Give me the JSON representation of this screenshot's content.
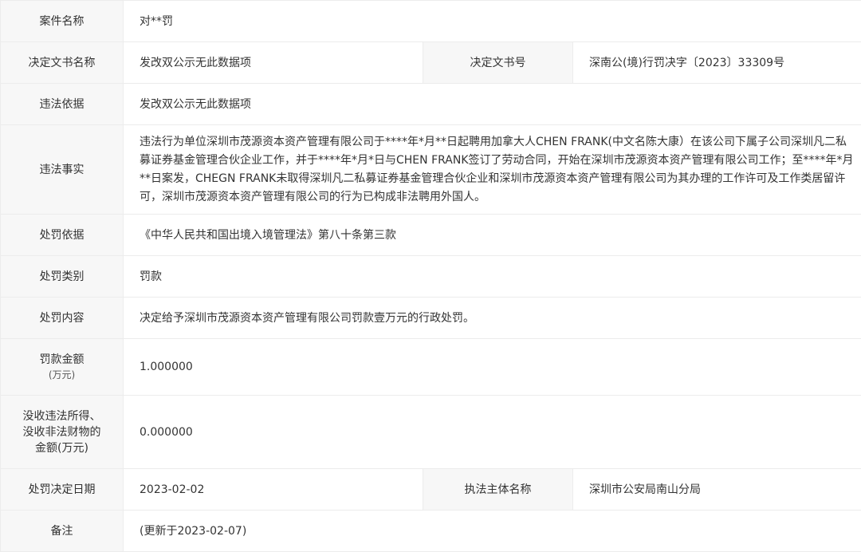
{
  "rows": {
    "case_name": {
      "label": "案件名称",
      "value": "对**罚"
    },
    "decision_doc_name": {
      "label": "决定文书名称",
      "value": "发改双公示无此数据项"
    },
    "decision_doc_no": {
      "label": "决定文书号",
      "value": "深南公(境)行罚决字〔2023〕33309号"
    },
    "violation_basis": {
      "label": "违法依据",
      "value": "发改双公示无此数据项"
    },
    "violation_facts": {
      "label": "违法事实",
      "value": "违法行为单位深圳市茂源资本资产管理有限公司于****年*月**日起聘用加拿大人CHEN FRANK(中文名陈大康）在该公司下属子公司深圳凡二私募证券基金管理合伙企业工作，并于****年*月*日与CHEN FRANK签订了劳动合同，开始在深圳市茂源资本资产管理有限公司工作；至****年*月**日案发，CHEGN FRANK未取得深圳凡二私募证券基金管理合伙企业和深圳市茂源资本资产管理有限公司为其办理的工作许可及工作类居留许可，深圳市茂源资本资产管理有限公司的行为已构成非法聘用外国人。"
    },
    "penalty_basis": {
      "label": "处罚依据",
      "value": "《中华人民共和国出境入境管理法》第八十条第三款"
    },
    "penalty_type": {
      "label": "处罚类别",
      "value": "罚款"
    },
    "penalty_content": {
      "label": "处罚内容",
      "value": "决定给予深圳市茂源资本资产管理有限公司罚款壹万元的行政处罚。"
    },
    "fine_amount": {
      "label": "罚款金额",
      "unit": "(万元)",
      "value": "1.000000"
    },
    "confiscation": {
      "label_lines": [
        "没收违法所得、",
        "没收非法财物的",
        "金额(万元)"
      ],
      "value": "0.000000"
    },
    "decision_date": {
      "label": "处罚决定日期",
      "value": "2023-02-02"
    },
    "enforcement_body": {
      "label": "执法主体名称",
      "value": "深圳市公安局南山分局"
    },
    "remarks": {
      "label": "备注",
      "value": "(更新于2023-02-07)"
    }
  }
}
